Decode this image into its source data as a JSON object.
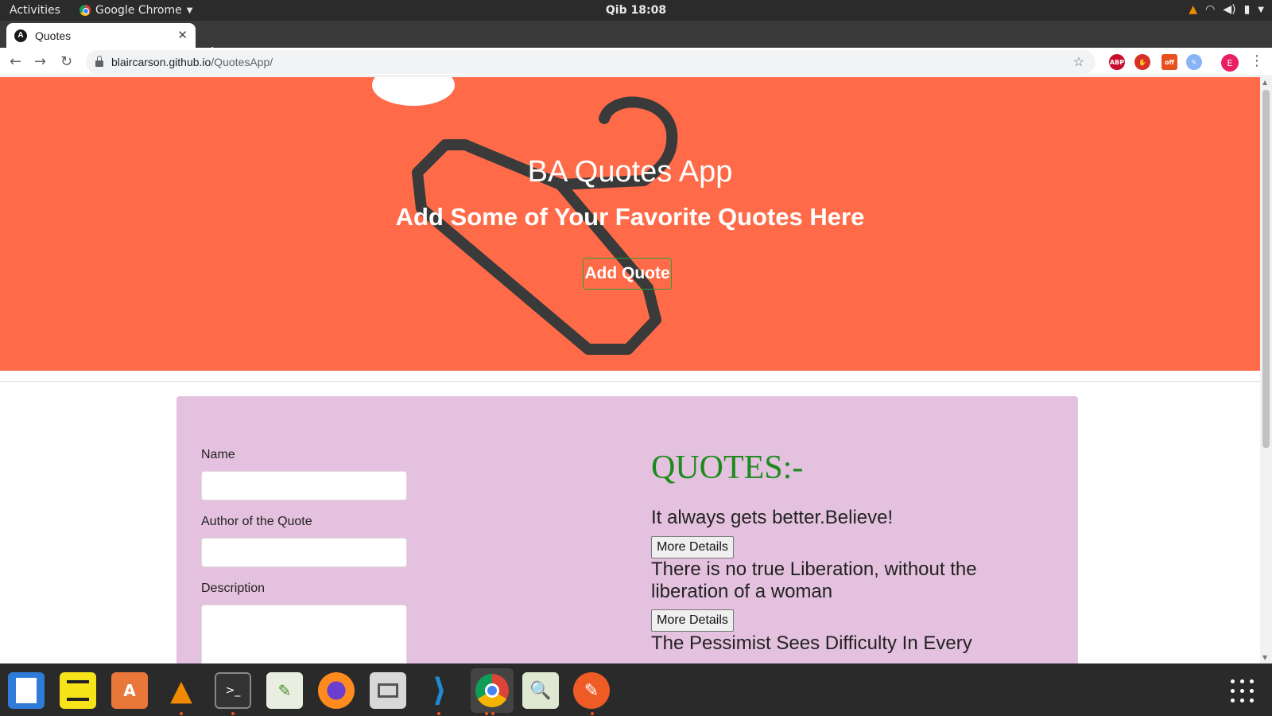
{
  "system_bar": {
    "activities": "Activities",
    "app_name": "Google Chrome",
    "clock": "Qib 18:08",
    "tray_icons": [
      "vlc-icon",
      "wifi-icon",
      "volume-icon",
      "battery-icon",
      "chevron-down-icon"
    ]
  },
  "browser": {
    "tab_title": "Quotes",
    "tab_favicon": "A",
    "new_tab": "+",
    "url_host": "blaircarson.github.io",
    "url_path": "/QuotesApp/",
    "extensions": [
      {
        "name": "adblock-icon",
        "label": "ABP",
        "color": "#c70d2c"
      },
      {
        "name": "privacy-badger-icon",
        "label": "✋",
        "color": "#d93025"
      },
      {
        "name": "ext-off-icon",
        "label": "off",
        "color": "#e8501e"
      },
      {
        "name": "ext-blue-icon",
        "label": "✎",
        "color": "#8ab4f8"
      }
    ],
    "profile_initial": "E"
  },
  "hero": {
    "title": "BA Quotes App",
    "subtitle": "Add Some of Your Favorite Quotes Here",
    "button_label": "Add Quote",
    "background_color": "#ff6b48"
  },
  "form": {
    "name_label": "Name",
    "name_value": "",
    "author_label": "Author of the Quote",
    "author_value": "",
    "description_label": "Description",
    "description_value": ""
  },
  "quotes": {
    "heading": "QUOTES:-",
    "heading_color": "#1d8a1d",
    "items": [
      {
        "text": "It always gets better.Believe!",
        "button": "More Details"
      },
      {
        "text": "There is no true Liberation, without the liberation of a woman",
        "button": "More Details"
      },
      {
        "text": "The Pessimist Sees Difficulty In Every"
      }
    ]
  },
  "card_color": "#e4c1de",
  "dock": {
    "apps": [
      "libreoffice-writer-icon",
      "notes-icon",
      "software-center-icon",
      "vlc-icon",
      "terminal-icon",
      "text-editor-icon",
      "firefox-icon",
      "files-icon",
      "vscode-icon",
      "chrome-icon",
      "image-viewer-icon",
      "postman-icon"
    ],
    "show_apps": "show-applications-icon"
  }
}
